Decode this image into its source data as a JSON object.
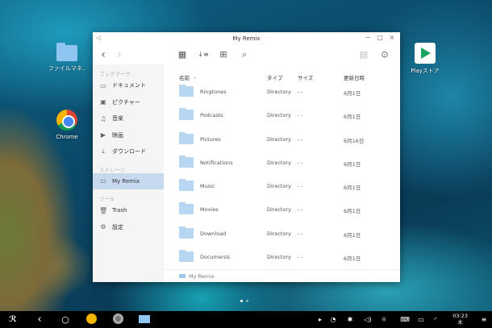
{
  "desktop": {
    "icons": [
      {
        "label": "ファイルマネ..",
        "icon": "folder-icon"
      },
      {
        "label": "Chrome",
        "icon": "chrome-icon"
      },
      {
        "label": "Playストア",
        "icon": "play-store-icon"
      }
    ],
    "page_dots": 2
  },
  "window": {
    "title": "My Remix",
    "controls": {
      "minimize": "−",
      "maximize": "□",
      "close": "×"
    },
    "toolbar": {
      "back": "‹",
      "forward": "›",
      "grid_view": "▦",
      "sort": "↓≡",
      "new_folder": "⊞",
      "search": "⌕",
      "clipboard": "▤",
      "select": "⊙"
    },
    "sidebar": {
      "sections": [
        {
          "title": "ブックマーク",
          "items": [
            {
              "label": "ドキュメント",
              "icon": "▭"
            },
            {
              "label": "ピクチャー",
              "icon": "▣"
            },
            {
              "label": "音楽",
              "icon": "♫"
            },
            {
              "label": "映画",
              "icon": "▶"
            },
            {
              "label": "ダウンロード",
              "icon": "⤓"
            }
          ]
        },
        {
          "title": "ストレージ",
          "items": [
            {
              "label": "My Remix",
              "icon": "▭",
              "active": true
            }
          ]
        },
        {
          "title": "ツール",
          "items": [
            {
              "label": "Trash",
              "icon": "🗑"
            },
            {
              "label": "設定",
              "icon": "⚙"
            }
          ]
        }
      ]
    },
    "columns": {
      "name": "名前",
      "sort_arrow": "⌄",
      "type": "タイプ",
      "size": "サイズ",
      "modified": "更新日時"
    },
    "files": [
      {
        "name": "Ringtones",
        "type": "Directory",
        "size": "- -",
        "modified": "6月1日"
      },
      {
        "name": "Podcasts",
        "type": "Directory",
        "size": "- -",
        "modified": "6月1日"
      },
      {
        "name": "Pictures",
        "type": "Directory",
        "size": "- -",
        "modified": "6月16日"
      },
      {
        "name": "Notifications",
        "type": "Directory",
        "size": "- -",
        "modified": "6月1日"
      },
      {
        "name": "Music",
        "type": "Directory",
        "size": "- -",
        "modified": "6月1日"
      },
      {
        "name": "Movies",
        "type": "Directory",
        "size": "- -",
        "modified": "6月1日"
      },
      {
        "name": "Download",
        "type": "Directory",
        "size": "- -",
        "modified": "6月1日"
      },
      {
        "name": "Documents",
        "type": "Directory",
        "size": "- -",
        "modified": "6月1日"
      }
    ],
    "status_path": "My Remix"
  },
  "taskbar": {
    "time": "03:23",
    "day": "木",
    "colors": {
      "bg": "#000000",
      "accent": "#f4b400"
    }
  }
}
